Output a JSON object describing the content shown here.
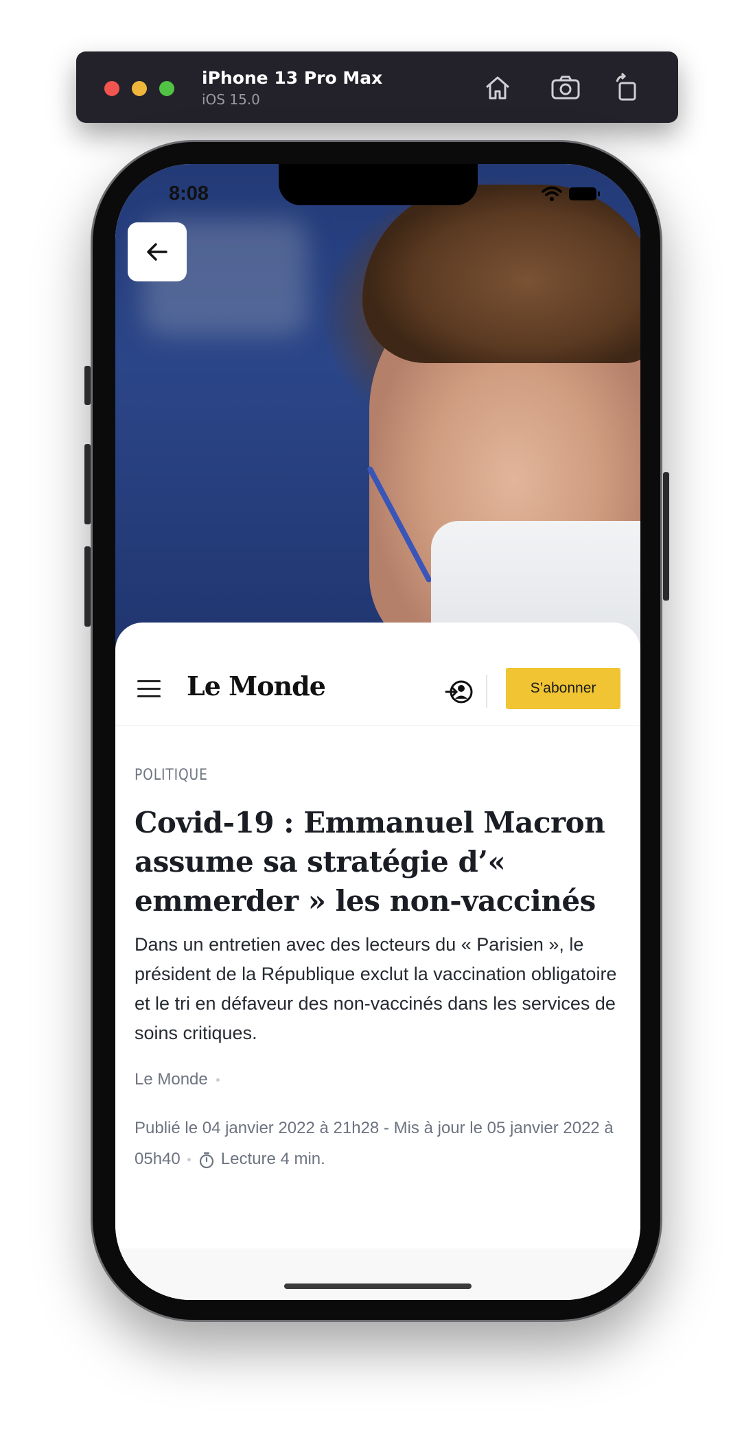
{
  "simulator": {
    "device_name": "iPhone 13 Pro Max",
    "os_version": "iOS 15.0",
    "icons": [
      "home-icon",
      "screenshot-icon",
      "rotate-icon"
    ]
  },
  "status_bar": {
    "time": "8:08",
    "icons": [
      "wifi-icon",
      "battery-icon"
    ]
  },
  "nav": {
    "logo_text": "Le Monde",
    "subscribe_label": "S’abonner",
    "subscribe_color": "#f0c432"
  },
  "article": {
    "category": "POLITIQUE",
    "headline": "Covid-19 : Emmanuel Macron assume sa stratégie d’« emmerder » les non-vaccinés",
    "lede": "Dans un entretien avec des lecteurs du « Parisien », le président de la République exclut la vaccination obligatoire et le tri en défaveur des non-vaccinés dans les services de soins critiques.",
    "source": "Le Monde",
    "published": "Publié le 04 janvier 2022 à 21h28 - Mis à jour le 05 janvier 2022 à 05h40",
    "reading_time": "Lecture 4 min."
  }
}
